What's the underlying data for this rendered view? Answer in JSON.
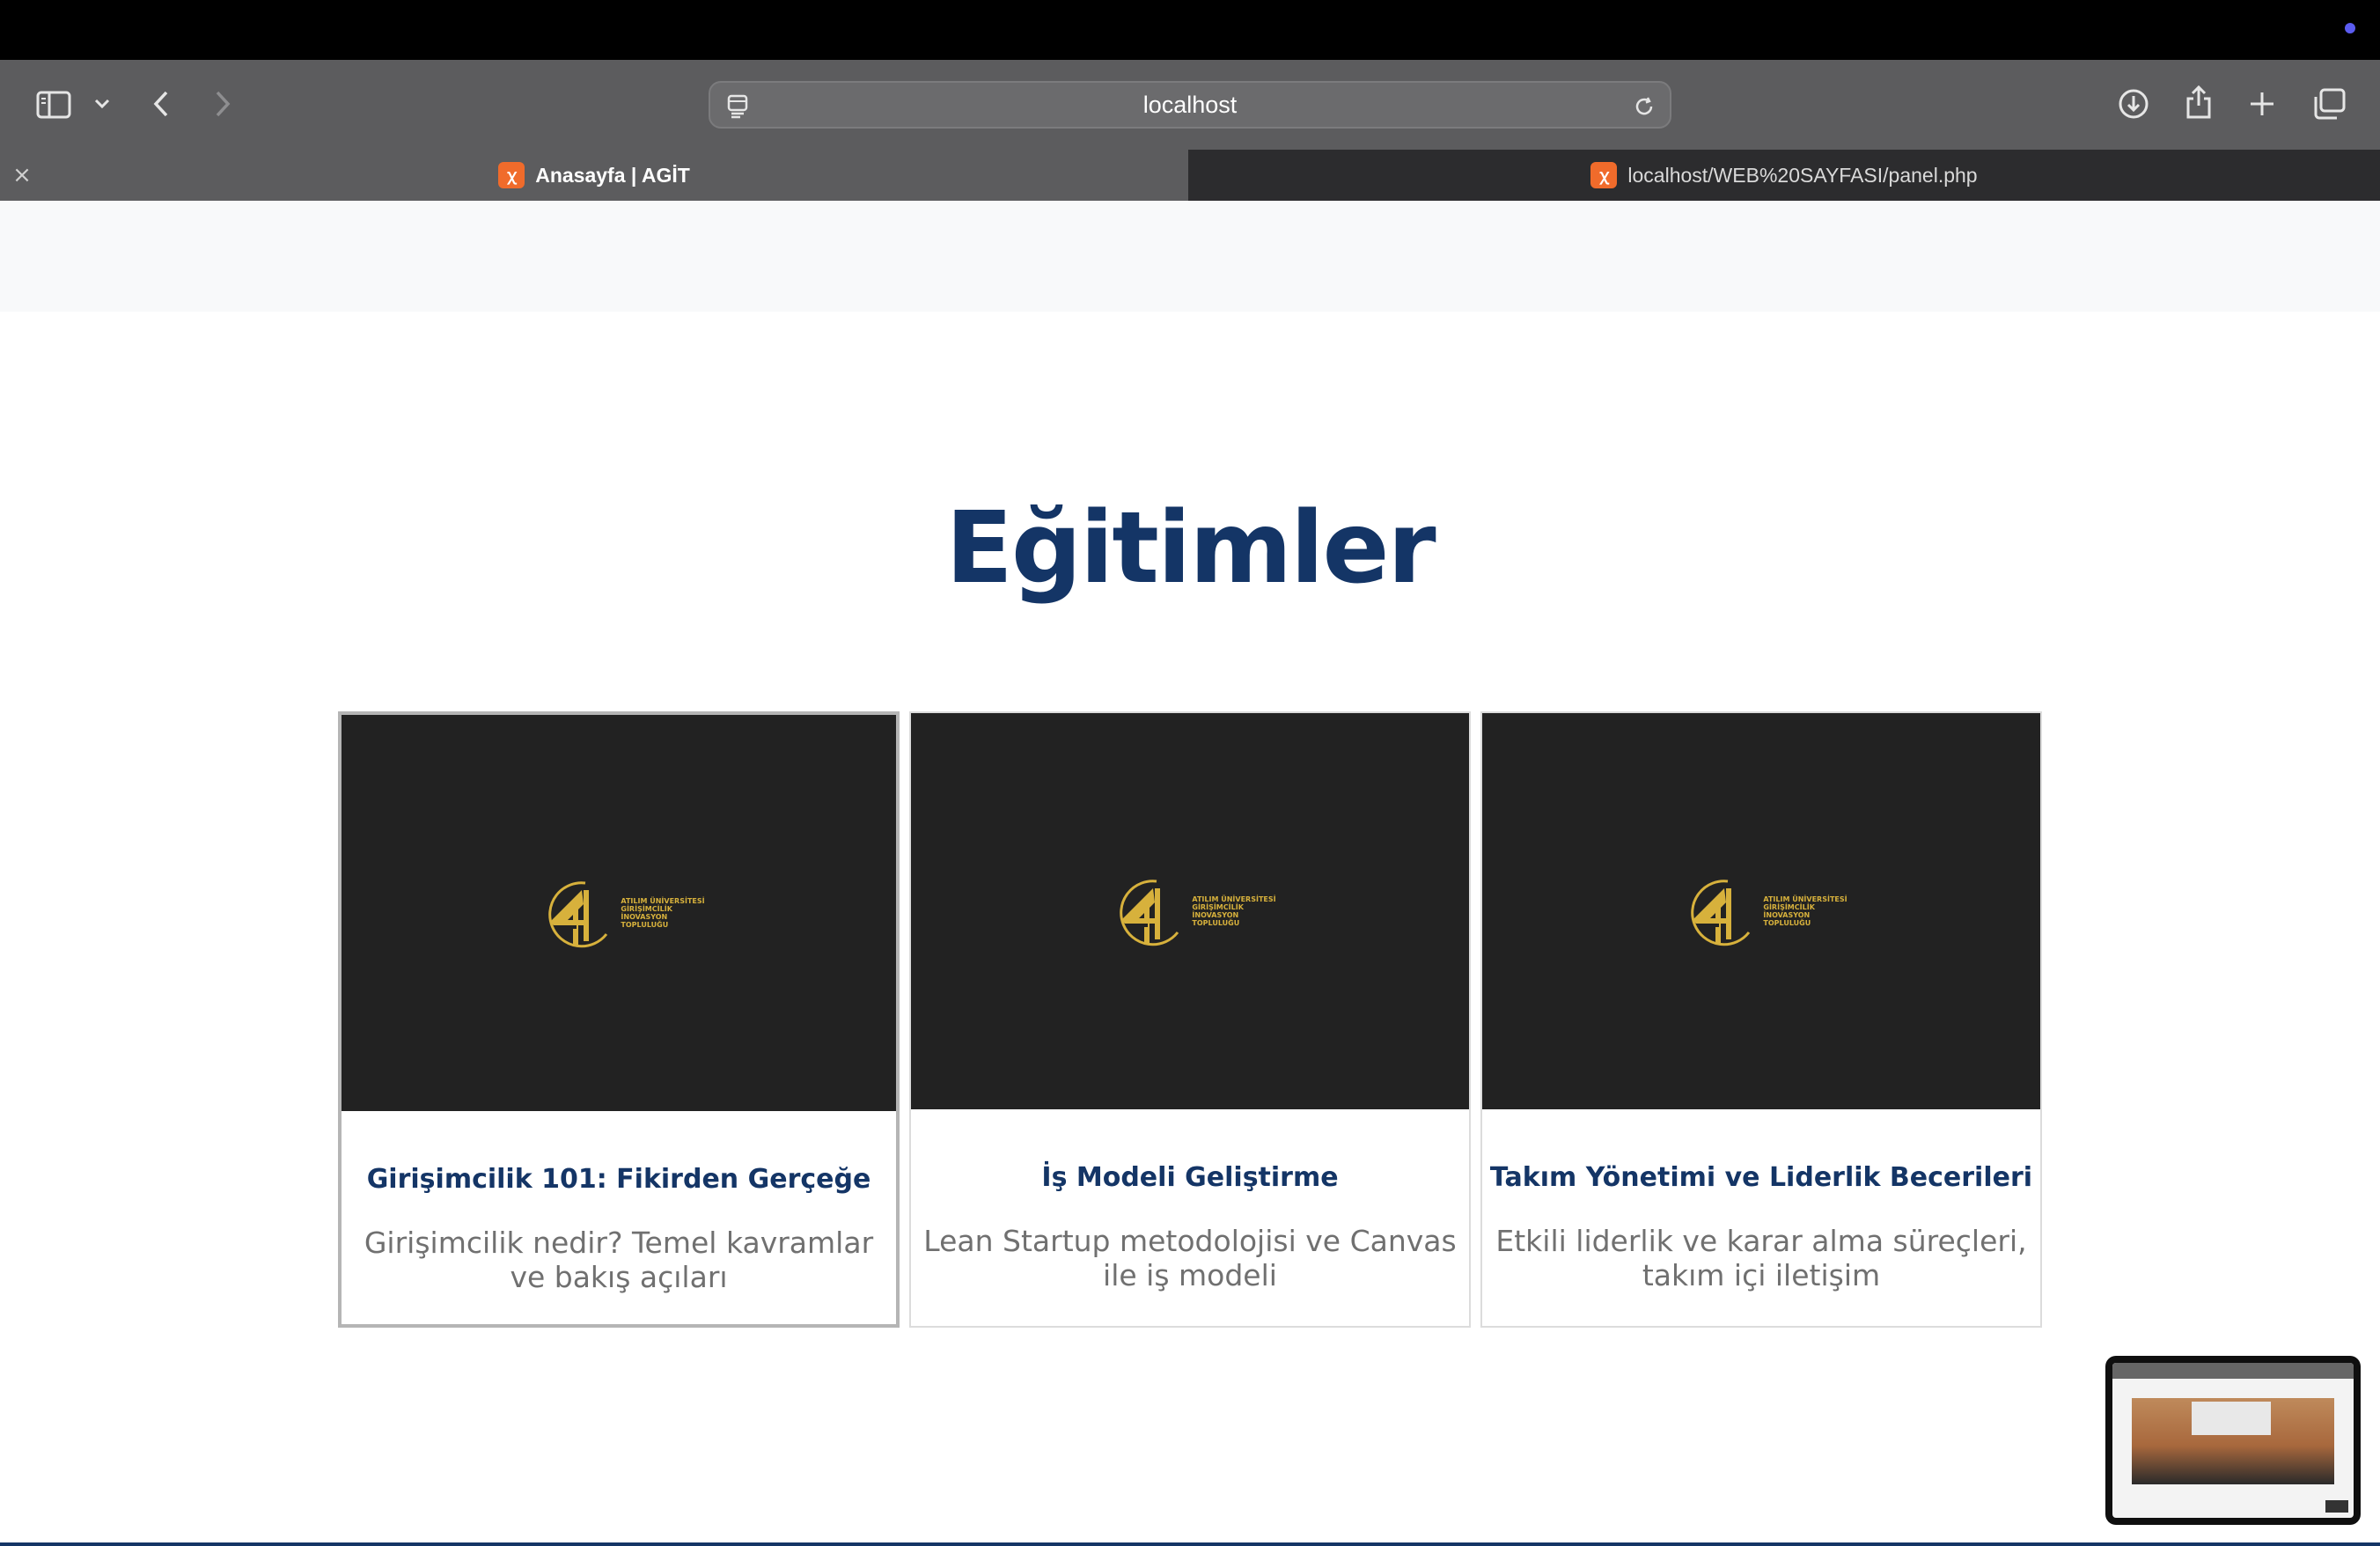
{
  "browser": {
    "address": "localhost",
    "tabs": [
      {
        "label": "Anasayfa | AGİT",
        "active": true
      },
      {
        "label": "localhost/WEB%20SAYFASI/panel.php",
        "active": false
      }
    ],
    "accent_color": "#5b5cf0",
    "favicon_color": "#f06b2b"
  },
  "section": {
    "title": "Eğitimler",
    "title_color": "#143566"
  },
  "cards": [
    {
      "title": "Girişimcilik 101: Fikirden Gerçeğe",
      "description": "Girişimcilik nedir? Temel kavramlar ve bakış açıları",
      "logo_lines": [
        "ATILIM ÜNİVERSİTESİ",
        "GİRİŞİMCİLİK",
        "İNOVASYON",
        "TOPLULUĞU"
      ]
    },
    {
      "title": "İş Modeli Geliştirme",
      "description": "Lean Startup metodolojisi ve Canvas ile iş modeli",
      "logo_lines": [
        "ATILIM ÜNİVERSİTESİ",
        "GİRİŞİMCİLİK",
        "İNOVASYON",
        "TOPLULUĞU"
      ]
    },
    {
      "title": "Takım Yönetimi ve Liderlik Becerileri",
      "description": "Etkili liderlik ve karar alma süreçleri, takım içi iletişim",
      "logo_lines": [
        "ATILIM ÜNİVERSİTESİ",
        "GİRİŞİMCİLİK",
        "İNOVASYON",
        "TOPLULUĞU"
      ]
    }
  ],
  "logo_color": "#d7b13c"
}
